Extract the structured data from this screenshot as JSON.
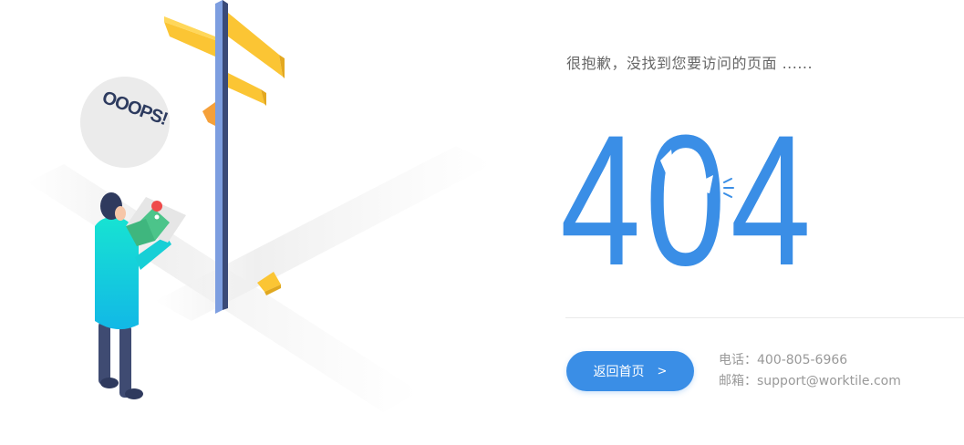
{
  "message": "很抱歉，没找到您要访问的页面 ......",
  "error_code": "404",
  "bubble_text": "OOOPS!",
  "home_button": {
    "label": "返回首页",
    "chevron": ">"
  },
  "contact": {
    "phone_label": "电话：",
    "phone": "400-805-6966",
    "email_label": "邮箱：",
    "email": "support@worktile.com"
  },
  "colors": {
    "accent": "#3a8ee6",
    "sign_yellow": "#fbc534",
    "sign_orange": "#f5a03a",
    "person_coat": "#17d2d6",
    "text_muted": "#999999"
  },
  "icons": [
    "signpost-illustration",
    "speech-bubble",
    "map-icon",
    "location-pin-icon",
    "chevron-right-icon"
  ]
}
